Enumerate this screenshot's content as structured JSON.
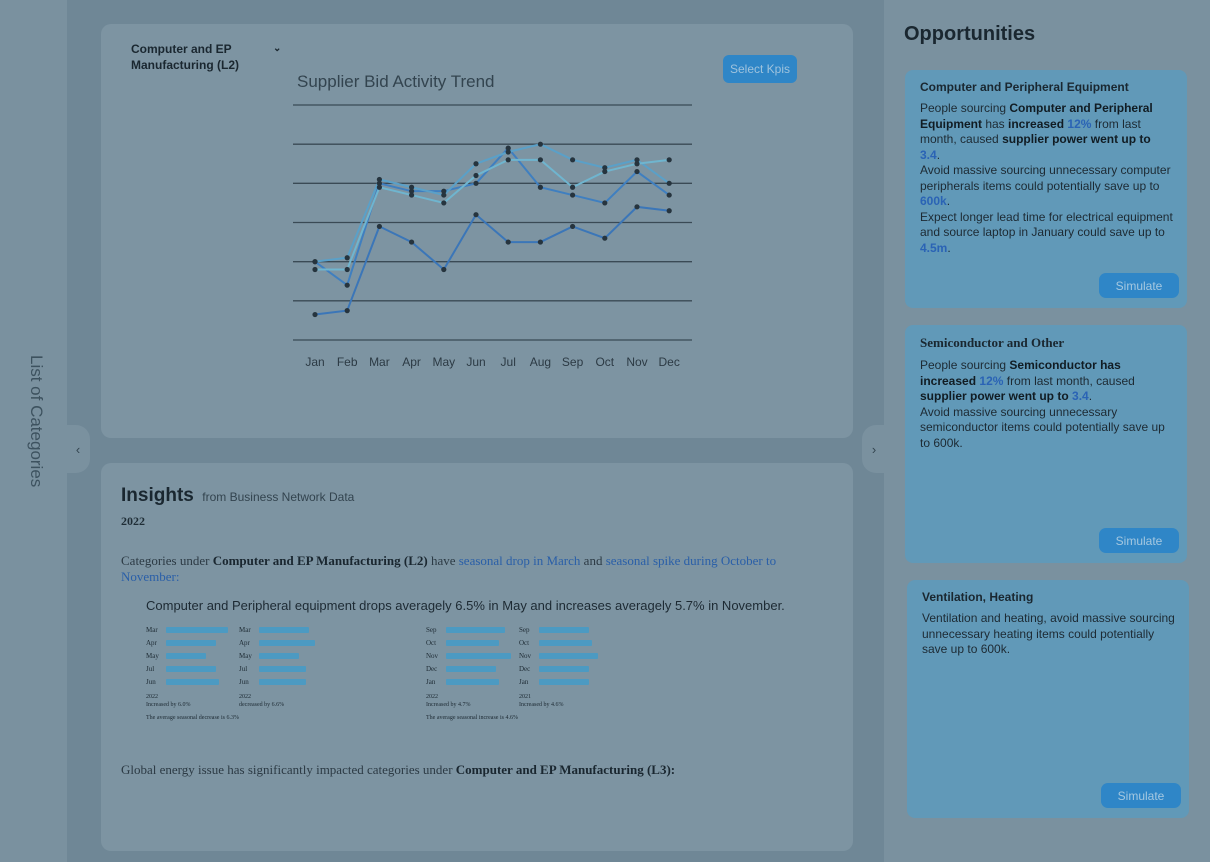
{
  "left_sidebar": {
    "title": "List of Categories"
  },
  "chart_panel": {
    "category_select": "Computer and EP Manufacturing (L2)",
    "select_kpi_button": "Select Kpis"
  },
  "chart_data": {
    "type": "line",
    "title": "Supplier Bid Activity Trend",
    "categories": [
      "Jan",
      "Feb",
      "Mar",
      "Apr",
      "May",
      "Jun",
      "Jul",
      "Aug",
      "Sep",
      "Oct",
      "Nov",
      "Dec"
    ],
    "ylim": [
      0,
      6
    ],
    "grid": true,
    "series": [
      {
        "color": "#3b76b8",
        "values": [
          0.65,
          0.75,
          2.9,
          2.5,
          1.8,
          3.2,
          2.5,
          2.5,
          2.9,
          2.6,
          3.4,
          3.3
        ]
      },
      {
        "color": "#3f7fc0",
        "values": [
          2.0,
          1.4,
          4.0,
          3.8,
          3.8,
          4.0,
          4.9,
          3.9,
          3.7,
          3.5,
          4.3,
          3.7
        ]
      },
      {
        "color": "#5aa0c8",
        "values": [
          2.0,
          2.1,
          4.1,
          3.9,
          3.7,
          4.5,
          4.8,
          5.0,
          4.6,
          4.4,
          4.6,
          4.0
        ]
      },
      {
        "color": "#6fb5cf",
        "values": [
          1.8,
          1.8,
          3.9,
          3.7,
          3.5,
          4.2,
          4.6,
          4.6,
          3.9,
          4.3,
          4.5,
          4.6
        ]
      }
    ]
  },
  "insights": {
    "title": "Insights",
    "subtitle": "from Business Network Data",
    "year": "2022",
    "summary_prefix": "Categories under ",
    "summary_category": "Computer and EP Manufacturing (L2)",
    "summary_mid1": " have ",
    "summary_link1": "seasonal drop in March",
    "summary_mid2": " and ",
    "summary_link2": "seasonal spike during October to November:",
    "detail": "Computer and Peripheral equipment drops averagely 6.5% in May and increases averagely 5.7% in November.",
    "mini_charts": [
      {
        "rows": [
          [
            "Mar",
            1.0
          ],
          [
            "Apr",
            0.8
          ],
          [
            "May",
            0.65
          ],
          [
            "Jul",
            0.8
          ],
          [
            "Jun",
            0.85
          ]
        ],
        "caption": [
          "2022",
          "Increased by 6.0%"
        ]
      },
      {
        "rows": [
          [
            "Mar",
            0.8
          ],
          [
            "Apr",
            0.9
          ],
          [
            "May",
            0.65
          ],
          [
            "Jul",
            0.75
          ],
          [
            "Jun",
            0.75
          ]
        ],
        "caption": [
          "2022",
          "decreased by 6.6%"
        ]
      },
      {
        "rows": [
          [
            "Sep",
            0.95
          ],
          [
            "Oct",
            0.85
          ],
          [
            "Nov",
            1.05
          ],
          [
            "Dec",
            0.8
          ],
          [
            "Jan",
            0.85
          ]
        ],
        "caption": [
          "2022",
          "Increased by 4.7%"
        ]
      },
      {
        "rows": [
          [
            "Sep",
            0.8
          ],
          [
            "Oct",
            0.85
          ],
          [
            "Nov",
            0.95
          ],
          [
            "Dec",
            0.8
          ],
          [
            "Jan",
            0.8
          ]
        ],
        "caption": [
          "2021",
          "Increased by 4.6%"
        ]
      }
    ],
    "mini_summary_left": "The average seasonal decrease is 6.3%",
    "mini_summary_right": "The average seasonal increase is 4.6%",
    "footer_prefix": "Global energy issue has significantly impacted categories under ",
    "footer_category": "Computer and EP Manufacturing (L3):"
  },
  "opportunities": {
    "title": "Opportunities",
    "cards": [
      {
        "title": "Computer and Peripheral Equipment",
        "p1_a": "People sourcing ",
        "p1_b": "Computer and Peripheral Equipment",
        "p1_c": " has ",
        "p1_d": "increased",
        "p1_e": " ",
        "p1_pct": "12%",
        "p1_f": " from last month, caused ",
        "p1_g": "supplier power went up to",
        "p1_h": " ",
        "p1_val": "3.4",
        "p1_i": ".",
        "p2_a": "Avoid massive sourcing unnecessary computer peripherals items could potentially save up to ",
        "p2_val": "600k",
        "p2_b": ".",
        "p3_a": "Expect longer lead time for electrical equipment and source laptop in January could save up to ",
        "p3_val": "4.5m",
        "p3_b": ".",
        "button": "Simulate"
      },
      {
        "title": "Semiconductor and Other",
        "p1_a": "People sourcing ",
        "p1_b": "Semiconductor has increased",
        "p1_c": " ",
        "p1_pct": "12%",
        "p1_d": " from last month, caused ",
        "p1_e": "supplier power went up to",
        "p1_f": " ",
        "p1_val": "3.4",
        "p1_g": ".",
        "p2": "Avoid massive sourcing unnecessary semiconductor items could potentially save up to 600k.",
        "button": "Simulate"
      },
      {
        "title": "Ventilation, Heating",
        "p1": "Ventilation and heating, avoid massive sourcing unnecessary heating items could potentially save up to 600k.",
        "button": "Simulate"
      }
    ]
  }
}
